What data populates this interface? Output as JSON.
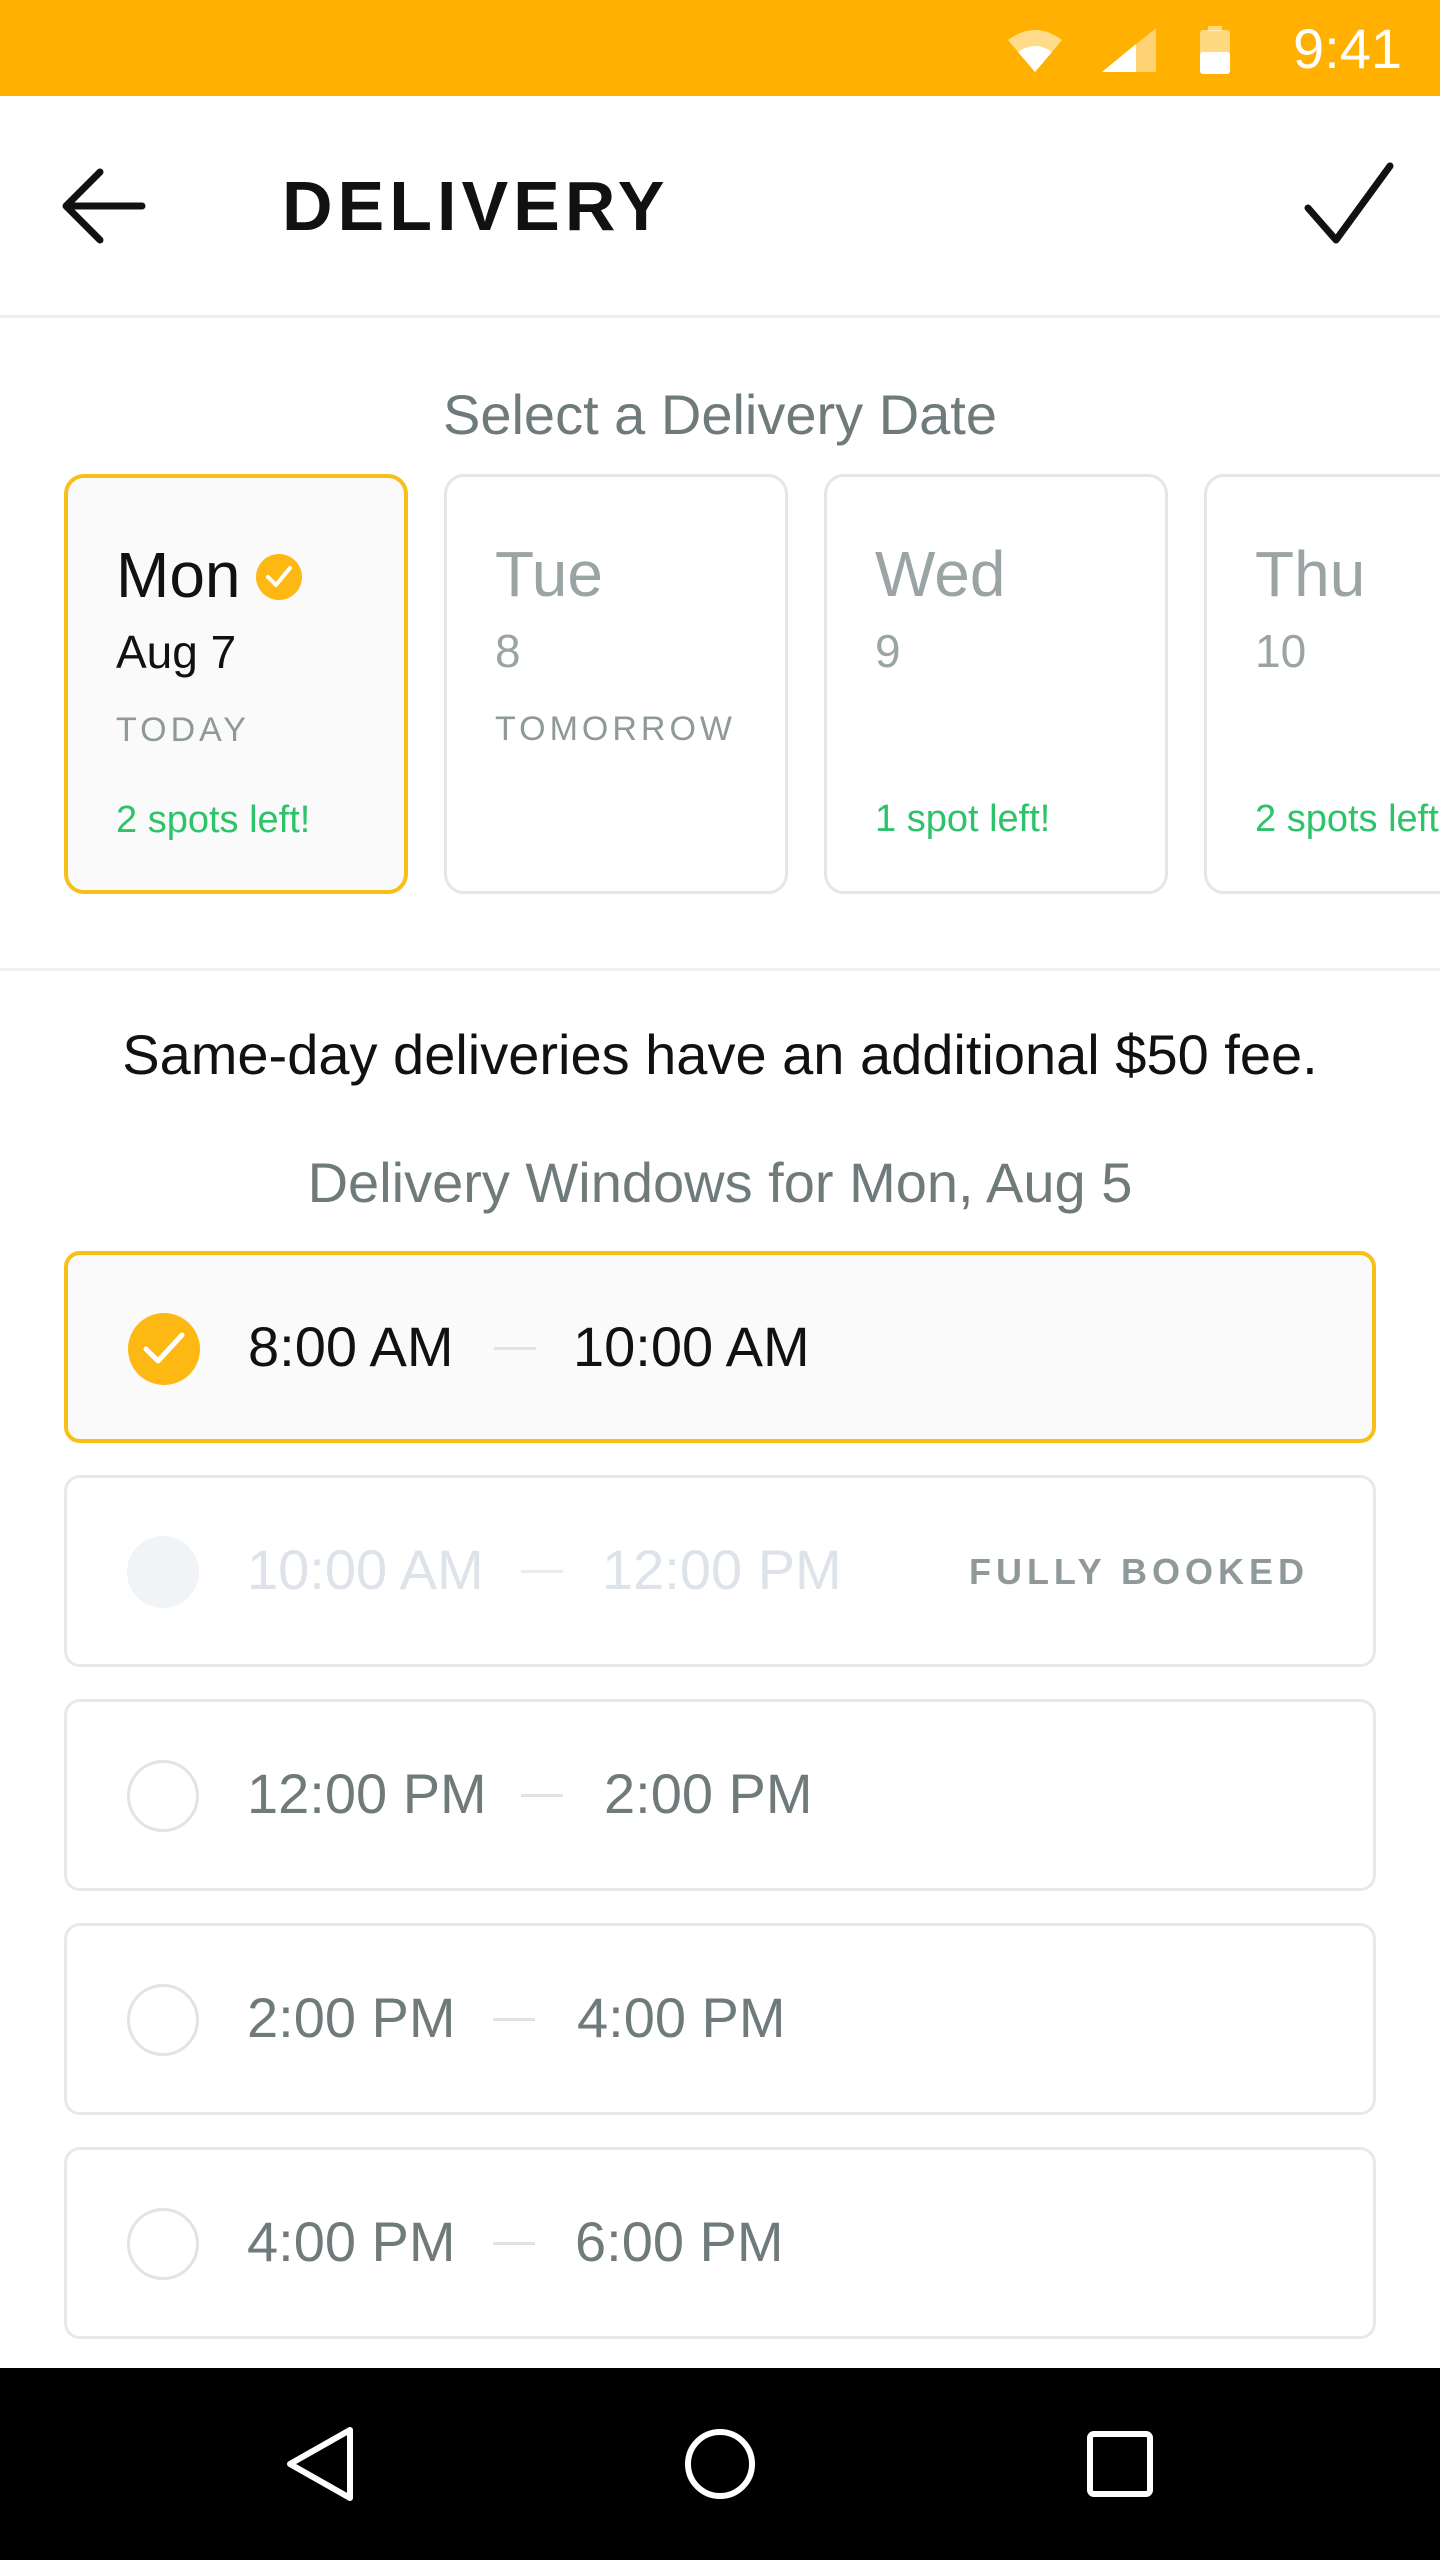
{
  "status_bar": {
    "time": "9:41",
    "icons": [
      "wifi-icon",
      "signal-icon",
      "battery-icon"
    ]
  },
  "app_bar": {
    "title": "DELIVERY",
    "back_icon": "arrow-left-icon",
    "confirm_icon": "check-icon"
  },
  "date_section": {
    "label": "Select a Delivery Date",
    "dates": [
      {
        "day": "Mon",
        "date": "Aug 7",
        "sub": "TODAY",
        "spots": "2 spots left!",
        "selected": true
      },
      {
        "day": "Tue",
        "date": "8",
        "sub": "TOMORROW",
        "spots": "",
        "selected": false
      },
      {
        "day": "Wed",
        "date": "9",
        "sub": "",
        "spots": "1 spot left!",
        "selected": false
      },
      {
        "day": "Thu",
        "date": "10",
        "sub": "",
        "spots": "2 spots left!",
        "selected": false
      }
    ]
  },
  "fee_note": "Same-day deliveries have an additional $50 fee.",
  "windows_section": {
    "label": "Delivery Windows for Mon, Aug 5",
    "windows": [
      {
        "start": "8:00 AM",
        "end": "10:00 AM",
        "status": "",
        "selected": true,
        "disabled": false
      },
      {
        "start": "10:00 AM",
        "end": "12:00 PM",
        "status": "FULLY BOOKED",
        "selected": false,
        "disabled": true
      },
      {
        "start": "12:00 PM",
        "end": "2:00 PM",
        "status": "",
        "selected": false,
        "disabled": false
      },
      {
        "start": "2:00 PM",
        "end": "4:00 PM",
        "status": "",
        "selected": false,
        "disabled": false
      },
      {
        "start": "4:00 PM",
        "end": "6:00 PM",
        "status": "",
        "selected": false,
        "disabled": false
      }
    ]
  },
  "nav_bar": {
    "icons": [
      "back-triangle-icon",
      "home-circle-icon",
      "recents-square-icon"
    ]
  },
  "colors": {
    "accent": "#FFB000",
    "selected_border": "#F7C019",
    "spots_green": "#2CC36B"
  }
}
